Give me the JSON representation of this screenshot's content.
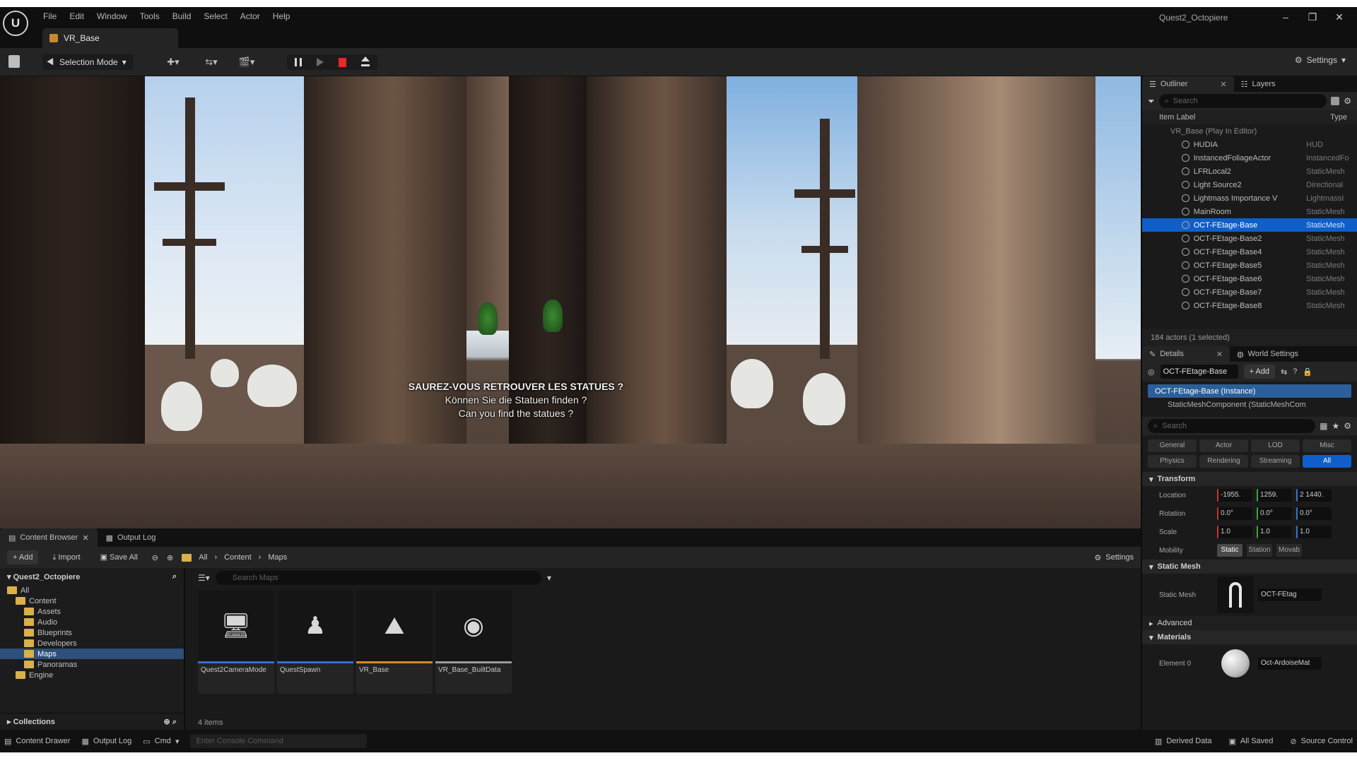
{
  "titlebar": {
    "menu": [
      "File",
      "Edit",
      "Window",
      "Tools",
      "Build",
      "Select",
      "Actor",
      "Help"
    ],
    "tab": "VR_Base",
    "project": "Quest2_Octopiere",
    "window_buttons": [
      "–",
      "❐",
      "✕"
    ]
  },
  "toolbar": {
    "mode": "Selection Mode",
    "settings": "Settings"
  },
  "viewport": {
    "caption_1": "SAUREZ-VOUS RETROUVER LES STATUES ?",
    "caption_2": "Können Sie die Statuen finden ?",
    "caption_3": "Can you find the statues ?"
  },
  "outliner": {
    "tab": "Outliner",
    "tab2": "Layers",
    "search_placeholder": "Search",
    "col_label": "Item Label",
    "col_type": "Type",
    "root": "VR_Base (Play In Editor)",
    "items": [
      {
        "name": "HUDIA",
        "type": "HUD"
      },
      {
        "name": "InstancedFoliageActor",
        "type": "InstancedFo"
      },
      {
        "name": "LFRLocal2",
        "type": "StaticMesh"
      },
      {
        "name": "Light Source2",
        "type": "Directional"
      },
      {
        "name": "Lightmass Importance V",
        "type": "LightmassI"
      },
      {
        "name": "MainRoom",
        "type": "StaticMesh"
      },
      {
        "name": "OCT-FEtage-Base",
        "type": "StaticMesh"
      },
      {
        "name": "OCT-FEtage-Base2",
        "type": "StaticMesh"
      },
      {
        "name": "OCT-FEtage-Base4",
        "type": "StaticMesh"
      },
      {
        "name": "OCT-FEtage-Base5",
        "type": "StaticMesh"
      },
      {
        "name": "OCT-FEtage-Base6",
        "type": "StaticMesh"
      },
      {
        "name": "OCT-FEtage-Base7",
        "type": "StaticMesh"
      },
      {
        "name": "OCT-FEtage-Base8",
        "type": "StaticMesh"
      }
    ],
    "selected_index": 6,
    "count": "184 actors (1 selected)"
  },
  "details": {
    "tab": "Details",
    "tab2": "World Settings",
    "actor_name": "OCT-FEtage-Base",
    "add": "+ Add",
    "component_root": "OCT-FEtage-Base (Instance)",
    "component_child": "StaticMeshComponent (StaticMeshCom",
    "search_placeholder": "Search",
    "filters": [
      "General",
      "Actor",
      "LOD",
      "Misc",
      "Physics",
      "Rendering",
      "Streaming",
      "All"
    ],
    "active_filter": "All",
    "transform_label": "Transform",
    "location_label": "Location",
    "location": [
      "-1955.",
      "1259.",
      "2 1440."
    ],
    "rotation_label": "Rotation",
    "rotation": [
      "0.0°",
      "0.0°",
      "0.0°"
    ],
    "scale_label": "Scale",
    "scale": [
      "1.0",
      "1.0",
      "1.0"
    ],
    "mobility_label": "Mobility",
    "mobility": [
      "Static",
      "Station",
      "Movab"
    ],
    "active_mobility": "Static",
    "static_mesh_section": "Static Mesh",
    "static_mesh_label": "Static Mesh",
    "static_mesh_value": "OCT-FEtag",
    "advanced_label": "Advanced",
    "materials_section": "Materials",
    "element_label": "Element 0",
    "material_value": "Oct-ArdoiseMat"
  },
  "content_browser": {
    "tab": "Content Browser",
    "tab2": "Output Log",
    "add": "+ Add",
    "import": "Import",
    "save_all": "Save All",
    "crumbs": [
      "All",
      "Content",
      "Maps"
    ],
    "settings": "Settings",
    "project": "Quest2_Octopiere",
    "tree": [
      {
        "label": "All",
        "depth": 0
      },
      {
        "label": "Content",
        "depth": 1
      },
      {
        "label": "Assets",
        "depth": 2
      },
      {
        "label": "Audio",
        "depth": 2
      },
      {
        "label": "Blueprints",
        "depth": 2
      },
      {
        "label": "Developers",
        "depth": 2
      },
      {
        "label": "Maps",
        "depth": 2
      },
      {
        "label": "Panoramas",
        "depth": 2
      },
      {
        "label": "Engine",
        "depth": 1
      }
    ],
    "selected_tree": 6,
    "collections": "Collections",
    "search_placeholder": "Search Maps",
    "assets": [
      {
        "name": "Quest2CameraMode",
        "color": "#3a6bd1",
        "icon": "monitor-icon"
      },
      {
        "name": "QuestSpawn",
        "color": "#3a6bd1",
        "icon": "pawn-icon"
      },
      {
        "name": "VR_Base",
        "color": "#d18a2b",
        "icon": "map-icon"
      },
      {
        "name": "VR_Base_BuiltData",
        "color": "#9a9a9a",
        "icon": "sphere-icon"
      }
    ],
    "count": "4 items"
  },
  "statusbar": {
    "drawer": "Content Drawer",
    "output": "Output Log",
    "cmd": "Cmd",
    "cmd_placeholder": "Enter Console Command",
    "derived": "Derived Data",
    "saved": "All Saved",
    "source": "Source Control"
  },
  "colors": {
    "accent": "#0e5fc9",
    "stop": "#e02b2b",
    "folder": "#d9b04a"
  }
}
